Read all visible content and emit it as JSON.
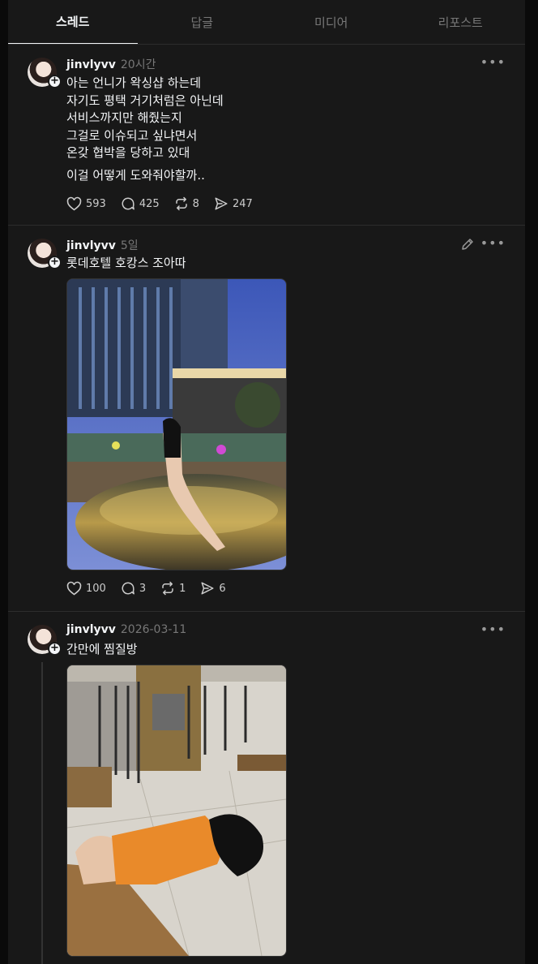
{
  "tabs": [
    "스레드",
    "답글",
    "미디어",
    "리포스트"
  ],
  "posts": [
    {
      "username": "jinvlyvv",
      "time": "20시간",
      "text": "아는 언니가 왁싱샵 하는데\n자기도 평택 거기처럼은 아닌데\n서비스까지만 해줬는지\n그걸로 이슈되고 싶냐면서\n온갖 협박을 당하고 있대",
      "text2": "이걸 어떻게 도와줘야할까..",
      "likes": "593",
      "comments": "425",
      "reposts": "8",
      "shares": "247"
    },
    {
      "username": "jinvlyvv",
      "time": "5일",
      "text": "롯데호텔 호캉스 조아따",
      "likes": "100",
      "comments": "3",
      "reposts": "1",
      "shares": "6"
    },
    {
      "username": "jinvlyvv",
      "time": "2026-03-11",
      "text": "간만에 찜질방"
    }
  ],
  "icons": {
    "like": "heart-icon",
    "comment": "comment-icon",
    "repost": "repost-icon",
    "share": "share-icon",
    "more": "more-icon",
    "edit": "pencil-icon"
  },
  "more_glyph": "•••"
}
